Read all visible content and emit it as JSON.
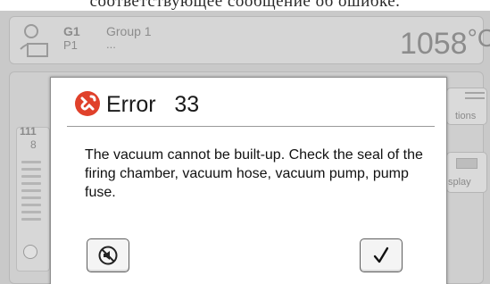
{
  "caption": {
    "text": "соответствующее сообщение об ошибке."
  },
  "header": {
    "group_code": "G1",
    "program_code": "P1",
    "group_name": "Group 1",
    "group_detail": "...",
    "temperature_value": "1058",
    "temperature_unit": "°C",
    "user_icon": "user-icon"
  },
  "background": {
    "left_panel_num1": "111",
    "left_panel_num2": "8",
    "right_button1_label": "tions",
    "right_button2_label": "splay"
  },
  "dialog": {
    "icon": "error-icon",
    "icon_color": "#e0412b",
    "title": "Error",
    "code": "33",
    "message": "The vacuum cannot be built-up. Check the seal of the firing chamber, vacuum hose, vacuum pump, pump fuse.",
    "buttons": [
      {
        "icon": "mute-sound-icon"
      },
      {
        "icon": "checkmark-icon"
      }
    ]
  }
}
